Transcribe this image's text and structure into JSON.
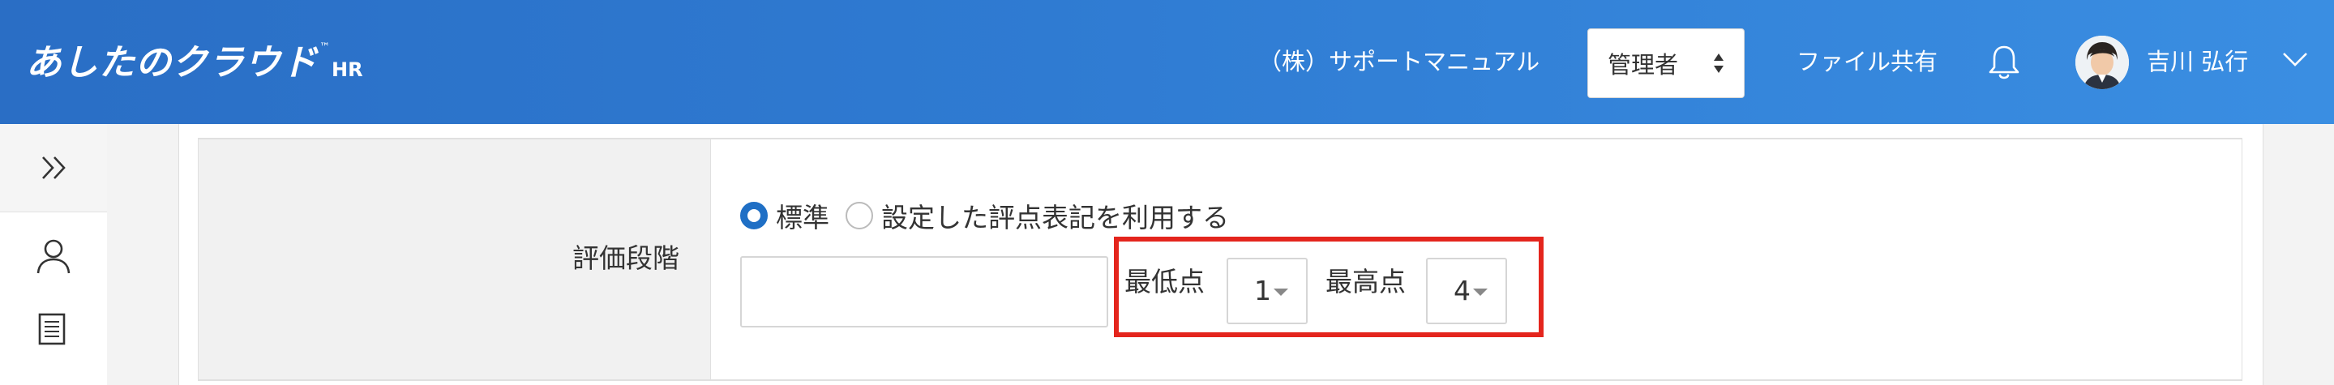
{
  "header": {
    "logo_main": "あしたのクラウド",
    "logo_tm": "™",
    "logo_suffix": "HR",
    "company": "（株）サポートマニュアル",
    "role_select_value": "管理者",
    "file_share": "ファイル共有",
    "user_name": "吉川 弘行"
  },
  "sidebar": {
    "icons": [
      "double-chevron-right-icon",
      "user-icon",
      "document-icon"
    ]
  },
  "form": {
    "row_label": "評価段階",
    "radio_options": [
      {
        "label": "標準",
        "selected": true
      },
      {
        "label": "設定した評点表記を利用する",
        "selected": false
      }
    ],
    "text_input_value": "",
    "min_label": "最低点",
    "min_value": "1",
    "max_label": "最高点",
    "max_value": "4"
  },
  "colors": {
    "header_blue": "#2f7bd2",
    "radio_selected": "#1f6fc5",
    "highlight_red": "#e4251d"
  }
}
